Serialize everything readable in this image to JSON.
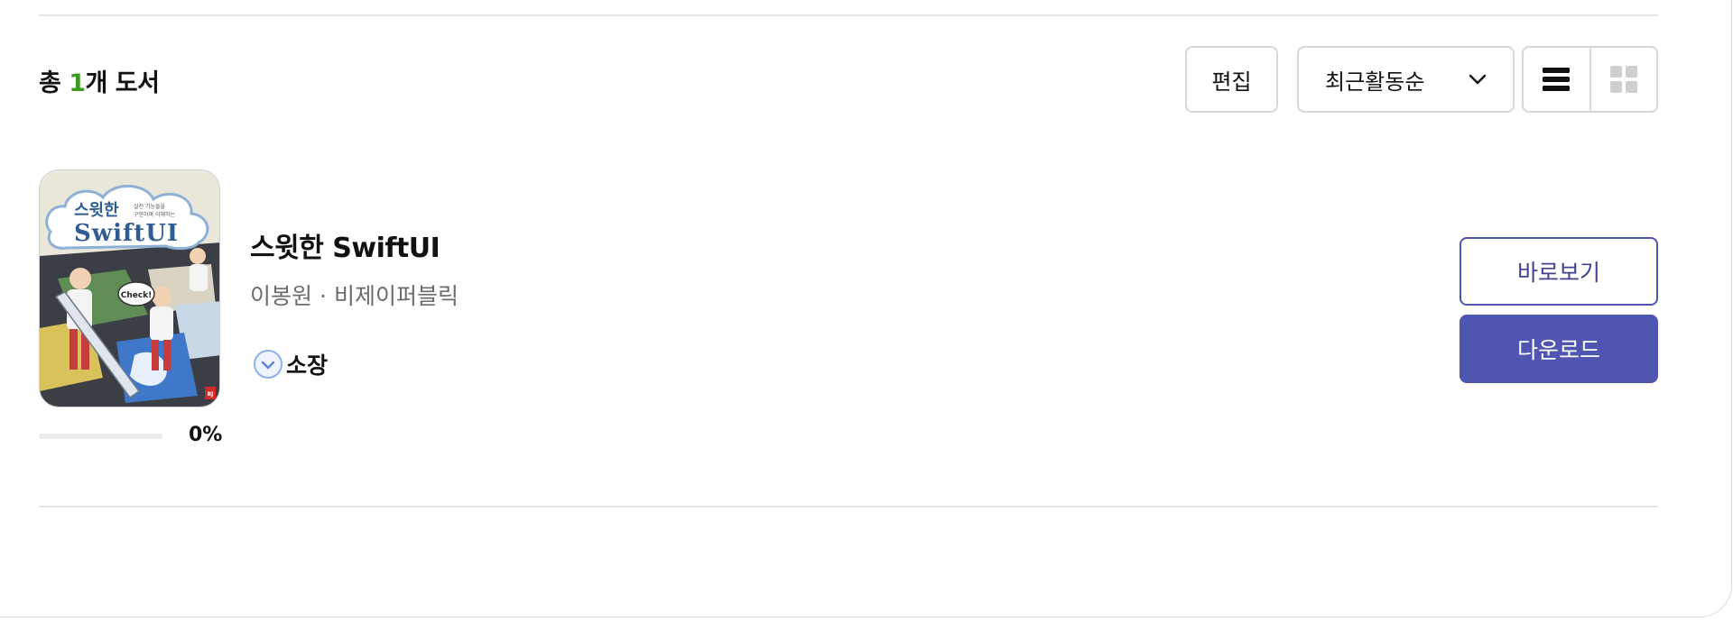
{
  "library": {
    "count_prefix": "총 ",
    "count_value": "1",
    "count_suffix": "개 도서"
  },
  "toolbar": {
    "edit_label": "편집",
    "sort_selected": "최근활동순",
    "view_modes": [
      "list",
      "grid"
    ],
    "active_view": "list"
  },
  "book": {
    "title": "스윗한 SwiftUI",
    "author": "이봉원",
    "separator": "·",
    "publisher": "비제이퍼블릭",
    "ownership_label": "소장",
    "progress_percent": 0,
    "progress_text": "0%",
    "cover_text": {
      "title_small": "스윗한",
      "title_large": "SwiftUI",
      "subtitle_1": "실전 기능들을",
      "subtitle_2": "구현하며 이해하는",
      "bubble": "Check!",
      "publisher_mark": "BJ"
    }
  },
  "actions": {
    "view_label": "바로보기",
    "download_label": "다운로드"
  },
  "colors": {
    "accent": "#5055b1",
    "count_highlight": "#3f9a24",
    "muted_text": "#6b6b6b",
    "border": "#d8d8d8"
  },
  "icons": {
    "sort_chevron": "chevron-down-icon",
    "list_view": "list-view-icon",
    "grid_view": "grid-view-icon",
    "owned": "check-circle-icon"
  }
}
